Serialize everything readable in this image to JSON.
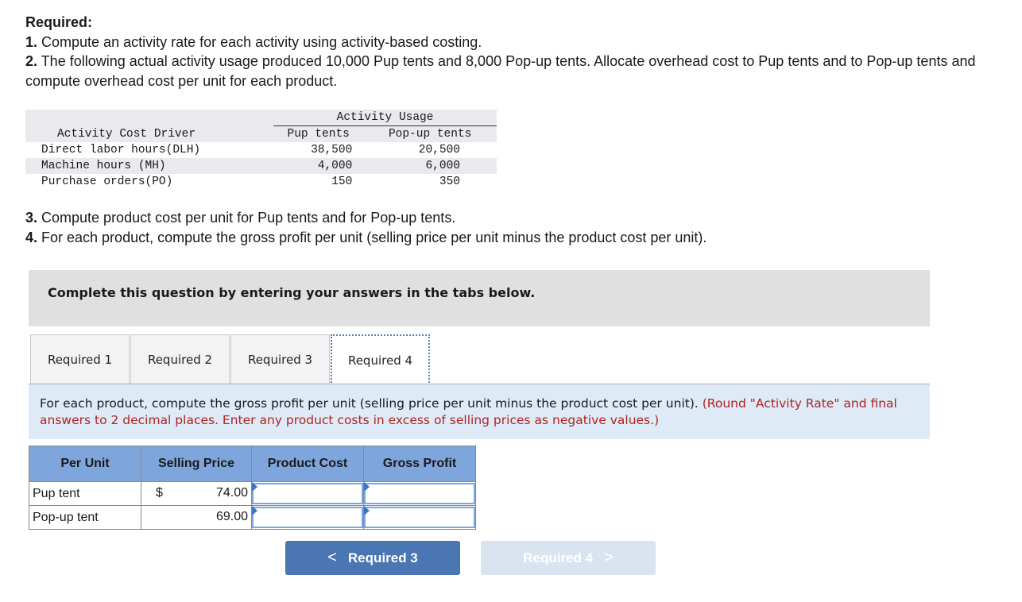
{
  "intro": {
    "heading": "Required:",
    "items": [
      {
        "num": "1.",
        "text": " Compute an activity rate for each activity using activity-based costing."
      },
      {
        "num": "2.",
        "text": " The following actual activity usage produced 10,000 Pup tents and 8,000 Pop-up tents. Allocate overhead cost to Pup tents and to Pop-up tents and compute overhead cost per unit for each product."
      }
    ]
  },
  "usage_table": {
    "group_header": "Activity Usage",
    "headers": [
      "Activity Cost Driver",
      "Pup tents",
      "Pop-up tents"
    ],
    "rows": [
      {
        "driver": "Direct labor hours(DLH)",
        "pup": "38,500",
        "pop": "20,500"
      },
      {
        "driver": "Machine hours (MH)",
        "pup": "4,000",
        "pop": "6,000"
      },
      {
        "driver": "Purchase orders(PO)",
        "pup": "150",
        "pop": "350"
      }
    ]
  },
  "intro2": {
    "items": [
      {
        "num": "3.",
        "text": " Compute product cost per unit for Pup tents and for Pop-up tents."
      },
      {
        "num": "4.",
        "text": " For each product, compute the gross profit per unit (selling price per unit minus the product cost per unit)."
      }
    ]
  },
  "banner": "Complete this question by entering your answers in the tabs below.",
  "tabs": [
    {
      "label": "Required 1",
      "active": false
    },
    {
      "label": "Required 2",
      "active": false
    },
    {
      "label": "Required 3",
      "active": false
    },
    {
      "label": "Required 4",
      "active": true
    }
  ],
  "instruction": {
    "text": "For each product, compute the gross profit per unit (selling price per unit minus the product cost per unit).",
    "note": "(Round \"Activity Rate\" and final answers to 2 decimal places. Enter any product costs in excess of selling prices as negative values.)"
  },
  "answer_table": {
    "headers": [
      "Per Unit",
      "Selling Price",
      "Product Cost",
      "Gross Profit"
    ],
    "rows": [
      {
        "label": "Pup tent",
        "currency": "$",
        "selling_price": "74.00",
        "product_cost": "",
        "gross_profit": ""
      },
      {
        "label": "Pop-up tent",
        "currency": "",
        "selling_price": "69.00",
        "product_cost": "",
        "gross_profit": ""
      }
    ]
  },
  "nav": {
    "prev_label": "Required 3",
    "next_label": "Required 4",
    "prev_chevron": "<",
    "next_chevron": ">"
  },
  "colors": {
    "header_blue": "#7ea6dc",
    "button_blue": "#4a76b4",
    "button_disabled": "#dae4f0",
    "note_red": "#b22222",
    "instruction_bg": "#deebf7"
  }
}
